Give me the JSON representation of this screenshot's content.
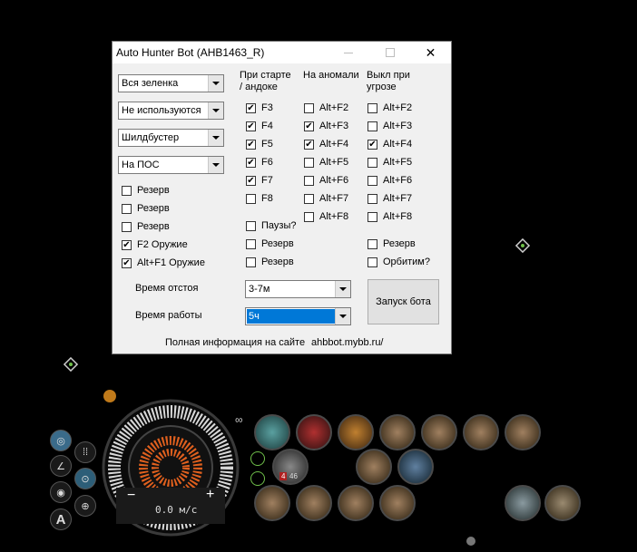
{
  "window": {
    "title": "Auto Hunter Bot (AHB1463_R)",
    "close_glyph": "✕"
  },
  "dropdowns": [
    "Вся зеленка",
    "Не используются",
    "Шилдбустер",
    "На ПОС"
  ],
  "left_checks": [
    {
      "label": "Резерв",
      "checked": false
    },
    {
      "label": "Резерв",
      "checked": false
    },
    {
      "label": "Резерв",
      "checked": false
    },
    {
      "label": "F2 Оружие",
      "checked": true
    },
    {
      "label": "Alt+F1 Оружие",
      "checked": true
    }
  ],
  "headers": {
    "col1": [
      "При старте",
      "/ андоке"
    ],
    "col2": [
      "На аномали"
    ],
    "col3": [
      "Выкл при",
      "угрозе"
    ]
  },
  "col1_keys": [
    {
      "label": "F3",
      "checked": true
    },
    {
      "label": "F4",
      "checked": true
    },
    {
      "label": "F5",
      "checked": true
    },
    {
      "label": "F6",
      "checked": true
    },
    {
      "label": "F7",
      "checked": true
    },
    {
      "label": "F8",
      "checked": false
    }
  ],
  "col1_extra": [
    {
      "label": "Паузы?",
      "checked": false
    },
    {
      "label": "Резерв",
      "checked": false
    },
    {
      "label": "Резерв",
      "checked": false
    }
  ],
  "col2_keys": [
    {
      "label": "Alt+F2",
      "checked": false
    },
    {
      "label": "Alt+F3",
      "checked": true
    },
    {
      "label": "Alt+F4",
      "checked": true
    },
    {
      "label": "Alt+F5",
      "checked": false
    },
    {
      "label": "Alt+F6",
      "checked": false
    },
    {
      "label": "Alt+F7",
      "checked": false
    },
    {
      "label": "Alt+F8",
      "checked": false
    }
  ],
  "col3_keys": [
    {
      "label": "Alt+F2",
      "checked": false
    },
    {
      "label": "Alt+F3",
      "checked": false
    },
    {
      "label": "Alt+F4",
      "checked": true
    },
    {
      "label": "Alt+F5",
      "checked": false
    },
    {
      "label": "Alt+F6",
      "checked": false
    },
    {
      "label": "Alt+F7",
      "checked": false
    },
    {
      "label": "Alt+F8",
      "checked": false
    }
  ],
  "col3_extra": [
    {
      "label": "Резерв",
      "checked": false
    },
    {
      "label": "Орбитим?",
      "checked": false
    }
  ],
  "idle_time": {
    "label": "Время отстоя",
    "value": "3-7м"
  },
  "work_time": {
    "label": "Время работы",
    "value": "5ч"
  },
  "start_button": "Запуск бота",
  "footer": {
    "info": "Полная информация на сайте",
    "site": "ahbbot.mybb.ru/"
  },
  "hud": {
    "speed": "0.0 м/с",
    "minus": "−",
    "plus": "+",
    "autopilot_letter": "A",
    "overheat_value": "4",
    "capacitor_text": "46"
  },
  "colors": {
    "selection": "#0078d7",
    "check": "#000000"
  }
}
